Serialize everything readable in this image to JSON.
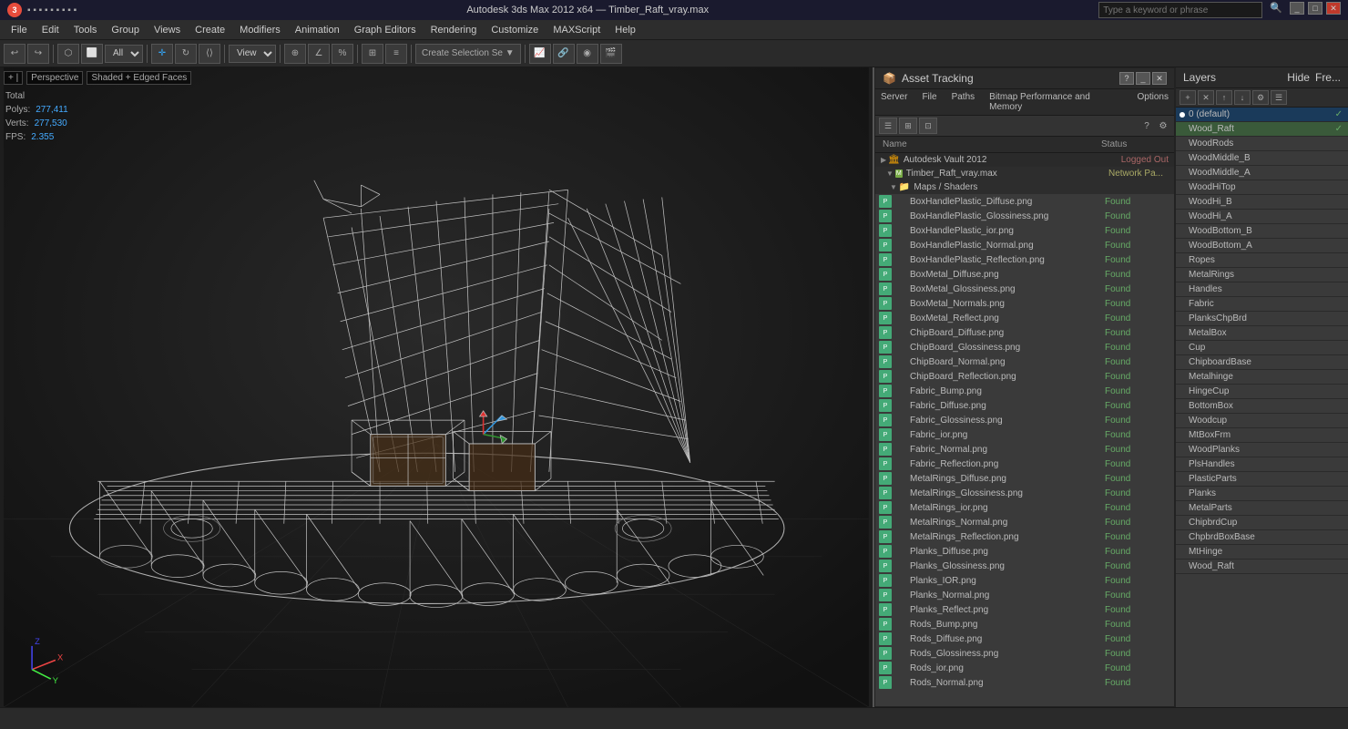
{
  "titlebar": {
    "app_name": "Autodesk 3ds Max 2012 x64",
    "file_name": "Timber_Raft_vray.max",
    "search_placeholder": "Type a keyword or phrase"
  },
  "menubar": {
    "items": [
      "File",
      "Edit",
      "Tools",
      "Group",
      "Views",
      "Create",
      "Modifiers",
      "Animation",
      "Graph Editors",
      "Rendering",
      "Customize",
      "MAXScript",
      "Help"
    ]
  },
  "viewport": {
    "label_bracket": "+ |",
    "label_view": "Perspective",
    "label_shading": "Shaded + Edged Faces",
    "stats": {
      "total": "Total",
      "polys_label": "Polys:",
      "polys_val": "277,411",
      "verts_label": "Verts:",
      "verts_val": "277,530",
      "fps_label": "FPS:",
      "fps_val": "2.355"
    }
  },
  "asset_tracking": {
    "title": "Asset Tracking",
    "menu_items": [
      "Server",
      "File",
      "Paths",
      "Bitmap Performance and Memory",
      "Options"
    ],
    "columns": {
      "name": "Name",
      "status": "Status"
    },
    "tree": {
      "vault": "Autodesk Vault 2012",
      "vault_status": "Logged Out",
      "file": "Timber_Raft_vray.max",
      "file_status": "Network Pa...",
      "maps_folder": "Maps / Shaders",
      "items": [
        {
          "name": "BoxHandlePlastic_Diffuse.png",
          "status": "Found"
        },
        {
          "name": "BoxHandlePlastic_Glossiness.png",
          "status": "Found"
        },
        {
          "name": "BoxHandlePlastic_ior.png",
          "status": "Found"
        },
        {
          "name": "BoxHandlePlastic_Normal.png",
          "status": "Found"
        },
        {
          "name": "BoxHandlePlastic_Reflection.png",
          "status": "Found"
        },
        {
          "name": "BoxMetal_Diffuse.png",
          "status": "Found"
        },
        {
          "name": "BoxMetal_Glossiness.png",
          "status": "Found"
        },
        {
          "name": "BoxMetal_Normals.png",
          "status": "Found"
        },
        {
          "name": "BoxMetal_Reflect.png",
          "status": "Found"
        },
        {
          "name": "ChipBoard_Diffuse.png",
          "status": "Found"
        },
        {
          "name": "ChipBoard_Glossiness.png",
          "status": "Found"
        },
        {
          "name": "ChipBoard_Normal.png",
          "status": "Found"
        },
        {
          "name": "ChipBoard_Reflection.png",
          "status": "Found"
        },
        {
          "name": "Fabric_Bump.png",
          "status": "Found"
        },
        {
          "name": "Fabric_Diffuse.png",
          "status": "Found"
        },
        {
          "name": "Fabric_Glossiness.png",
          "status": "Found"
        },
        {
          "name": "Fabric_ior.png",
          "status": "Found"
        },
        {
          "name": "Fabric_Normal.png",
          "status": "Found"
        },
        {
          "name": "Fabric_Reflection.png",
          "status": "Found"
        },
        {
          "name": "MetalRings_Diffuse.png",
          "status": "Found"
        },
        {
          "name": "MetalRings_Glossiness.png",
          "status": "Found"
        },
        {
          "name": "MetalRings_ior.png",
          "status": "Found"
        },
        {
          "name": "MetalRings_Normal.png",
          "status": "Found"
        },
        {
          "name": "MetalRings_Reflection.png",
          "status": "Found"
        },
        {
          "name": "Planks_Diffuse.png",
          "status": "Found"
        },
        {
          "name": "Planks_Glossiness.png",
          "status": "Found"
        },
        {
          "name": "Planks_IOR.png",
          "status": "Found"
        },
        {
          "name": "Planks_Normal.png",
          "status": "Found"
        },
        {
          "name": "Planks_Reflect.png",
          "status": "Found"
        },
        {
          "name": "Rods_Bump.png",
          "status": "Found"
        },
        {
          "name": "Rods_Diffuse.png",
          "status": "Found"
        },
        {
          "name": "Rods_Glossiness.png",
          "status": "Found"
        },
        {
          "name": "Rods_ior.png",
          "status": "Found"
        },
        {
          "name": "Rods_Normal.png",
          "status": "Found"
        }
      ]
    }
  },
  "layers": {
    "title": "Layers",
    "hide_label": "Hide",
    "freeze_label": "Fre...",
    "items": [
      {
        "name": "0 (default)",
        "active": true,
        "selected": false
      },
      {
        "name": "Wood_Raft",
        "active": false,
        "selected": true
      },
      {
        "name": "WoodRods",
        "active": false,
        "selected": false
      },
      {
        "name": "WoodMiddle_B",
        "active": false,
        "selected": false
      },
      {
        "name": "WoodMiddle_A",
        "active": false,
        "selected": false
      },
      {
        "name": "WoodHiTop",
        "active": false,
        "selected": false
      },
      {
        "name": "WoodHi_B",
        "active": false,
        "selected": false
      },
      {
        "name": "WoodHi_A",
        "active": false,
        "selected": false
      },
      {
        "name": "WoodBottom_B",
        "active": false,
        "selected": false
      },
      {
        "name": "WoodBottom_A",
        "active": false,
        "selected": false
      },
      {
        "name": "Ropes",
        "active": false,
        "selected": false
      },
      {
        "name": "MetalRings",
        "active": false,
        "selected": false
      },
      {
        "name": "Handles",
        "active": false,
        "selected": false
      },
      {
        "name": "Fabric",
        "active": false,
        "selected": false
      },
      {
        "name": "PlanksChpBrd",
        "active": false,
        "selected": false
      },
      {
        "name": "MetalBox",
        "active": false,
        "selected": false
      },
      {
        "name": "Cup",
        "active": false,
        "selected": false
      },
      {
        "name": "ChipboardBase",
        "active": false,
        "selected": false
      },
      {
        "name": "Metalhinge",
        "active": false,
        "selected": false
      },
      {
        "name": "HingeCup",
        "active": false,
        "selected": false
      },
      {
        "name": "BottomBox",
        "active": false,
        "selected": false
      },
      {
        "name": "Woodcup",
        "active": false,
        "selected": false
      },
      {
        "name": "MtBoxFrm",
        "active": false,
        "selected": false
      },
      {
        "name": "WoodPlanks",
        "active": false,
        "selected": false
      },
      {
        "name": "PlsHandles",
        "active": false,
        "selected": false
      },
      {
        "name": "PlasticParts",
        "active": false,
        "selected": false
      },
      {
        "name": "Planks",
        "active": false,
        "selected": false
      },
      {
        "name": "MetalParts",
        "active": false,
        "selected": false
      },
      {
        "name": "ChipbrdCup",
        "active": false,
        "selected": false
      },
      {
        "name": "ChpbrdBoxBase",
        "active": false,
        "selected": false
      },
      {
        "name": "MtHinge",
        "active": false,
        "selected": false
      },
      {
        "name": "Wood_Raft",
        "active": false,
        "selected": false
      }
    ]
  },
  "statusbar": {
    "text": ""
  }
}
